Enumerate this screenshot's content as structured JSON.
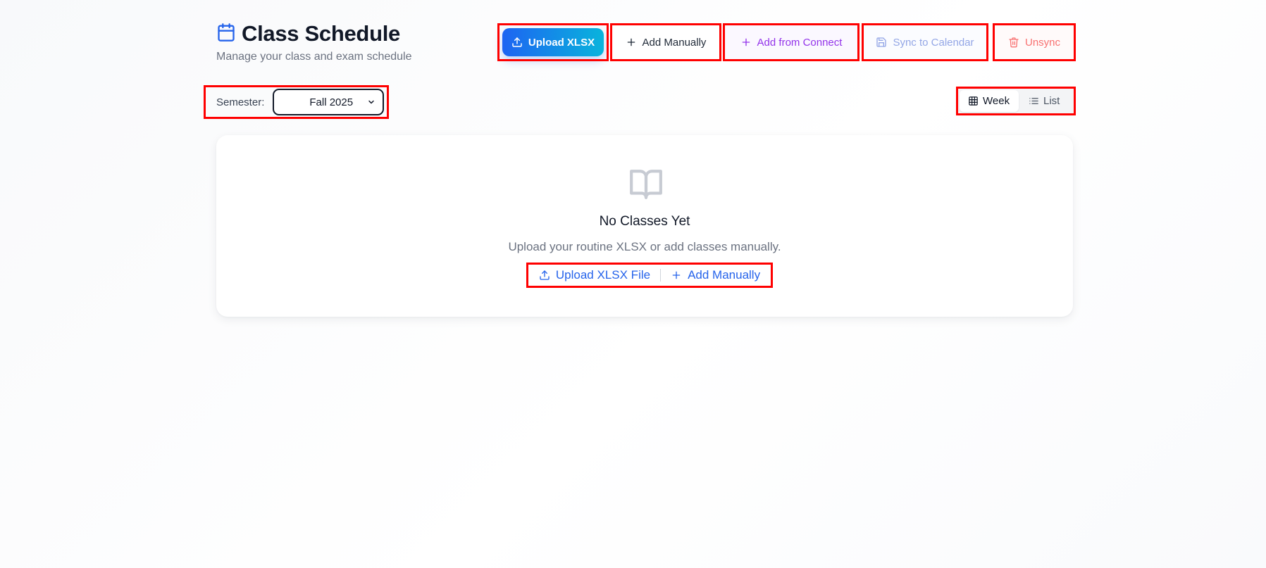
{
  "header": {
    "title": "Class Schedule",
    "subtitle": "Manage your class and exam schedule"
  },
  "toolbar": {
    "upload_label": "Upload XLSX",
    "add_manual_label": "Add Manually",
    "add_connect_label": "Add from Connect",
    "sync_label": "Sync to Calendar",
    "unsync_label": "Unsync"
  },
  "semester": {
    "label": "Semester:",
    "selected": "Fall 2025"
  },
  "view_toggle": {
    "week_label": "Week",
    "list_label": "List",
    "active": "Week"
  },
  "empty_state": {
    "title": "No Classes Yet",
    "message": "Upload your routine XLSX or add classes manually.",
    "upload_link": "Upload XLSX File",
    "add_link": "Add Manually"
  },
  "colors": {
    "primary": "#2563eb",
    "connect": "#9333ea",
    "sync": "#93a6e6",
    "unsync": "#f87171",
    "highlight": "#ff0000"
  }
}
